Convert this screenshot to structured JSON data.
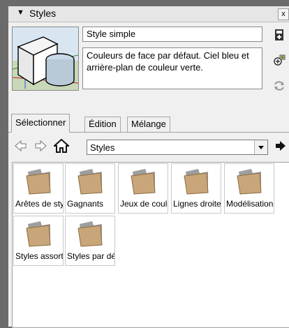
{
  "panel": {
    "title": "Styles",
    "collapse_icon": "triangle-down-icon",
    "close_label": "x"
  },
  "style": {
    "name": "Style simple",
    "description": "Couleurs de face par défaut. Ciel bleu et arrière-plan de couleur verte."
  },
  "side_icons": [
    "create-style-icon",
    "update-style-icon",
    "refresh-icon"
  ],
  "tabs": [
    {
      "label": "Sélectionner",
      "active": true
    },
    {
      "label": "Édition",
      "active": false
    },
    {
      "label": "Mélange",
      "active": false
    }
  ],
  "nav": {
    "back_icon": "back-arrow-icon",
    "forward_icon": "forward-arrow-icon",
    "home_icon": "home-icon",
    "collection": "Styles",
    "details_icon": "details-arrow-icon"
  },
  "folders": [
    {
      "label": "Arêtes de style"
    },
    {
      "label": "Gagnants"
    },
    {
      "label": "Jeux de couleurs"
    },
    {
      "label": "Lignes droites"
    },
    {
      "label": "Modélisation"
    },
    {
      "label": "Styles assortis"
    },
    {
      "label": "Styles par défaut"
    }
  ],
  "colors": {
    "background": "#6b6b6b",
    "panel": "#f0f0f0",
    "folder": "#c9a679"
  }
}
